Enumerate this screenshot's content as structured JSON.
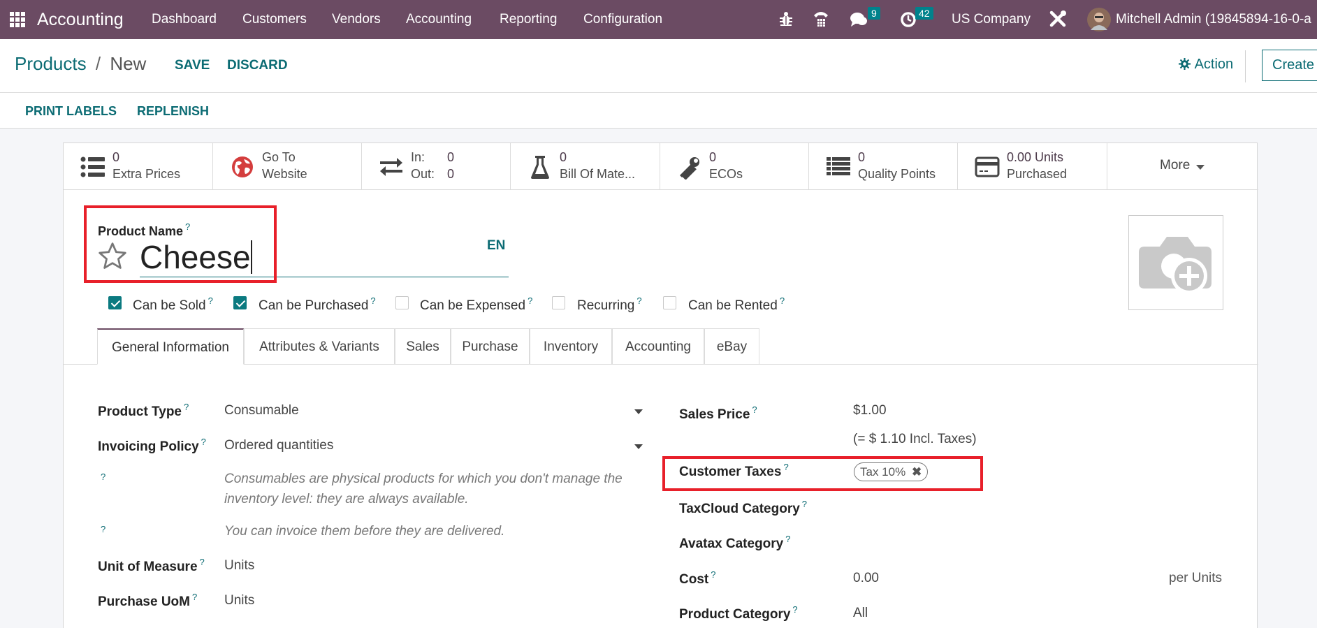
{
  "navbar": {
    "app_name": "Accounting",
    "menu": [
      "Dashboard",
      "Customers",
      "Vendors",
      "Accounting",
      "Reporting",
      "Configuration"
    ],
    "messages_count": "9",
    "activities_count": "42",
    "company": "US Company",
    "user": "Mitchell Admin (19845894-16-0-a",
    "colors": {
      "bar": "#6b4b63",
      "badge": "#00828c"
    }
  },
  "control_panel": {
    "breadcrumb_parent": "Products",
    "breadcrumb_sep": "/",
    "breadcrumb_current": "New",
    "save_label": "SAVE",
    "discard_label": "DISCARD",
    "action_label": "Action",
    "create_label": "Create",
    "print_labels": "PRINT LABELS",
    "replenish": "REPLENISH"
  },
  "smart_buttons": [
    {
      "icon": "list-icon",
      "value": "0",
      "label": "Extra Prices"
    },
    {
      "icon": "globe-icon",
      "value": "Go To",
      "label": "Website"
    },
    {
      "icon": "exchange-icon",
      "in_label": "In:",
      "in_value": "0",
      "out_label": "Out:",
      "out_value": "0"
    },
    {
      "icon": "flask-icon",
      "value": "0",
      "label": "Bill Of Mate..."
    },
    {
      "icon": "wrench-icon",
      "value": "0",
      "label": "ECOs"
    },
    {
      "icon": "list-alt-icon",
      "value": "0",
      "label": "Quality Points"
    },
    {
      "icon": "credit-card-icon",
      "value": "0.00 Units",
      "label": "Purchased"
    },
    {
      "label": "More"
    }
  ],
  "product": {
    "name_label": "Product Name",
    "name_value": "Cheese",
    "lang": "EN",
    "help": "?"
  },
  "checkboxes": [
    {
      "label": "Can be Sold",
      "checked": true
    },
    {
      "label": "Can be Purchased",
      "checked": true
    },
    {
      "label": "Can be Expensed",
      "checked": false
    },
    {
      "label": "Recurring",
      "checked": false
    },
    {
      "label": "Can be Rented",
      "checked": false
    }
  ],
  "tabs": [
    "General Information",
    "Attributes & Variants",
    "Sales",
    "Purchase",
    "Inventory",
    "Accounting",
    "eBay"
  ],
  "left_fields": {
    "product_type_label": "Product Type",
    "product_type_value": "Consumable",
    "invoicing_policy_label": "Invoicing Policy",
    "invoicing_policy_value": "Ordered quantities",
    "help_text_1a": "Consumables are physical products for which you don't manage the",
    "help_text_1b": "inventory level: they are always available.",
    "help_text_2": "You can invoice them before they are delivered.",
    "uom_label": "Unit of Measure",
    "uom_value": "Units",
    "purchase_uom_label": "Purchase UoM",
    "purchase_uom_value": "Units"
  },
  "right_fields": {
    "sales_price_label": "Sales Price",
    "sales_price_value": "$1.00",
    "incl_taxes": "(= $ 1.10 Incl. Taxes)",
    "customer_taxes_label": "Customer Taxes",
    "customer_taxes_tag": "Tax 10%",
    "taxcloud_label": "TaxCloud Category",
    "avatax_label": "Avatax Category",
    "cost_label": "Cost",
    "cost_value": "0.00",
    "cost_unit": "per Units",
    "category_label": "Product Category",
    "category_value": "All"
  }
}
